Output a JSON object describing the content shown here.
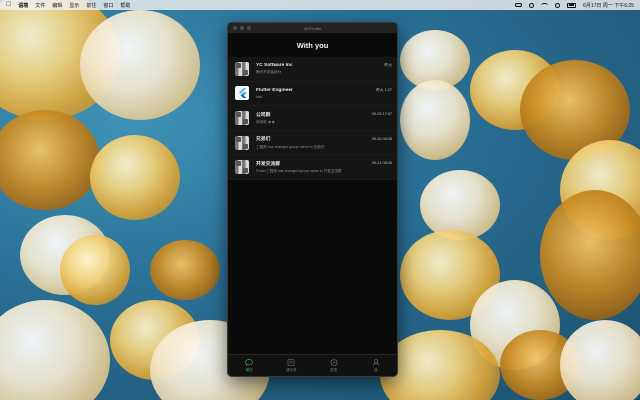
{
  "menubar": {
    "items": [
      "语境",
      "文件",
      "编辑",
      "显示",
      "前往",
      "窗口",
      "帮助"
    ],
    "clock": "6月17日 周一 下午6:25"
  },
  "window": {
    "title": "WXFlutter"
  },
  "header": {
    "title": "With you"
  },
  "chats": [
    {
      "name": "YC Software Inc",
      "time": "昨天",
      "message": "腾讯开发者部分",
      "avatar": "grid-avatar"
    },
    {
      "name": "Flutter Engineer",
      "time": "昨天 1:27",
      "message": "hah",
      "avatar": "flutter-logo"
    },
    {
      "name": "公司群",
      "time": "05-26 17:07",
      "message": "哈哈哈 ★★",
      "avatar": "grid-avatar"
    },
    {
      "name": "兄弟们",
      "time": "05-26 08:08",
      "message": "工程师 has changed group name to 兄弟们",
      "avatar": "grid-avatar"
    },
    {
      "name": "开发交流群",
      "time": "05-24 08:06",
      "message": "Flutter工程师 has changed group name to 开发交流群",
      "avatar": "grid-avatar"
    }
  ],
  "tabs": [
    {
      "label": "微信",
      "icon": "chat-icon",
      "active": true
    },
    {
      "label": "通讯录",
      "icon": "contacts-icon",
      "active": false
    },
    {
      "label": "发现",
      "icon": "compass-icon",
      "active": false
    },
    {
      "label": "我",
      "icon": "person-icon",
      "active": false
    }
  ],
  "colors": {
    "accent": "#2fa85a",
    "window_bg": "#0b0b0b"
  }
}
